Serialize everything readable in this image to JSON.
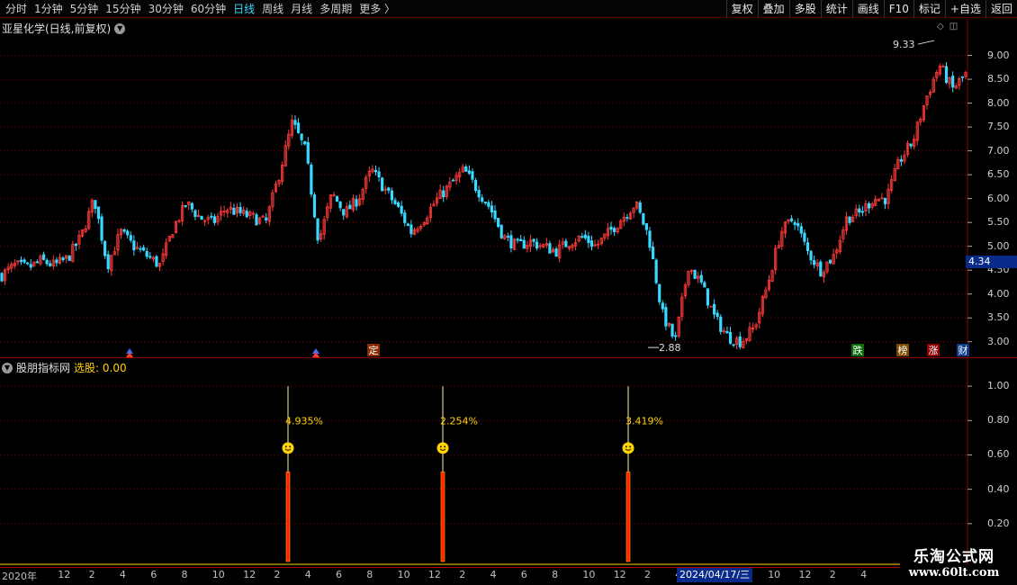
{
  "toolbar": {
    "periods": [
      "分时",
      "1分钟",
      "5分钟",
      "15分钟",
      "30分钟",
      "60分钟",
      "日线",
      "周线",
      "月线",
      "多周期",
      "更多 〉"
    ],
    "active_period": "日线",
    "tools": [
      "复权",
      "叠加",
      "多股",
      "统计",
      "画线",
      "F10",
      "标记",
      "+自选",
      "返回"
    ]
  },
  "main": {
    "title": "亚星化学(日线,前复权)",
    "price_labels": [
      "9.00",
      "8.50",
      "8.00",
      "7.50",
      "7.00",
      "6.50",
      "6.00",
      "5.50",
      "5.00",
      "4.50",
      "4.00",
      "3.50",
      "3.00"
    ],
    "current_price": "4.34",
    "high_note": "9.33",
    "low_note": "2.88",
    "markers": [
      "定",
      "跌",
      "榜",
      "涨",
      "财"
    ]
  },
  "indicator": {
    "name": "股朋指标网",
    "value_text": "选股: 0.00",
    "labels": [
      "1.00",
      "0.80",
      "0.60",
      "0.40",
      "0.20"
    ],
    "signals": [
      "4.935%",
      "2.254%",
      "3.419%"
    ]
  },
  "time_axis": {
    "labels": [
      "2020年",
      "12",
      "2",
      "4",
      "6",
      "8",
      "10",
      "12",
      "2",
      "4",
      "6",
      "8",
      "10",
      "12",
      "2",
      "4",
      "6",
      "8",
      "10",
      "12",
      "2",
      "4",
      "6",
      "8",
      "10",
      "12",
      "2",
      "4"
    ],
    "cursor_date": "2024/04/17/三"
  },
  "watermark": {
    "name": "乐淘公式网",
    "url": "www.60lt.com"
  },
  "colors": {
    "up": "#ff3a3a",
    "down": "#38d8ff",
    "grid": "#8a0000",
    "signal": "#ffd400"
  },
  "chart_data": [
    {
      "type": "candlestick",
      "title": "亚星化学(日线,前复权)",
      "ylim": [
        2.75,
        9.35
      ],
      "annotations": [
        {
          "label": "9.33"
        },
        {
          "label": "2.88"
        }
      ],
      "close_path": [
        4.4,
        4.6,
        4.55,
        4.7,
        4.6,
        4.75,
        5.2,
        6.0,
        4.6,
        5.3,
        5.0,
        4.8,
        4.6,
        5.4,
        5.9,
        5.6,
        5.5,
        5.8,
        5.7,
        5.6,
        5.5,
        6.5,
        7.6,
        7.0,
        5.1,
        6.1,
        5.7,
        6.0,
        6.6,
        6.2,
        5.8,
        5.3,
        5.6,
        6.0,
        6.3,
        6.6,
        6.2,
        5.8,
        5.2,
        5.0,
        5.1,
        5.0,
        4.9,
        5.1,
        5.2,
        5.0,
        5.3,
        5.6,
        5.9,
        5.2,
        3.6,
        3.0,
        4.6,
        4.2,
        3.5,
        3.1,
        3.0,
        3.3,
        4.2,
        5.3,
        5.6,
        4.9,
        4.5,
        4.8,
        5.6,
        5.7,
        6.0,
        6.0,
        6.8,
        7.2,
        8.1,
        8.8,
        8.3,
        8.6
      ]
    },
    {
      "type": "bar",
      "title": "选股",
      "ylim": [
        0,
        1.1
      ],
      "signals": [
        {
          "label": "4.935%",
          "value": 0.5
        },
        {
          "label": "2.254%",
          "value": 0.5
        },
        {
          "label": "3.419%",
          "value": 0.5
        }
      ]
    }
  ]
}
